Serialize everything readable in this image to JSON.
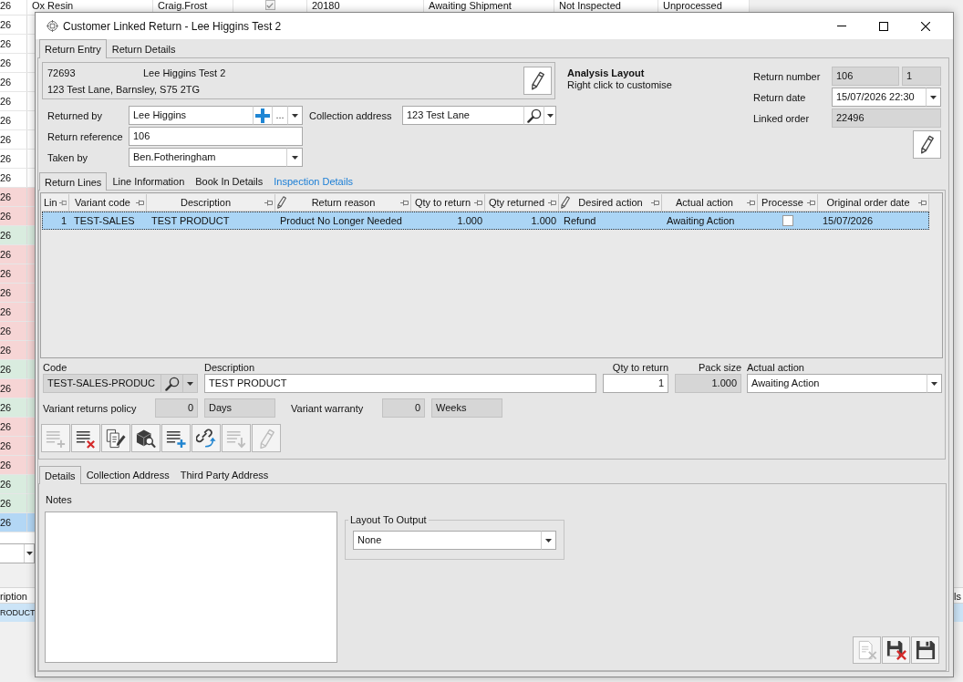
{
  "background_app": {
    "top_row": {
      "cells": [
        {
          "kind": "text",
          "text": "26"
        },
        {
          "kind": "text",
          "text": "Ox Resin"
        },
        {
          "kind": "text",
          "text": "Craig.Frost"
        },
        {
          "kind": "checkbox",
          "checked": true
        },
        {
          "kind": "text",
          "text": "20180"
        },
        {
          "kind": "text",
          "text": "Awaiting Shipment"
        },
        {
          "kind": "text",
          "text": "Not Inspected"
        },
        {
          "kind": "text",
          "text": "Unprocessed"
        }
      ]
    },
    "rows": [
      {
        "column_1": "26",
        "color": "#ffffff",
        "selected": false
      },
      {
        "column_1": "26",
        "color": "#ffffff",
        "selected": false
      },
      {
        "column_1": "26",
        "color": "#ffffff",
        "selected": false
      },
      {
        "column_1": "26",
        "color": "#ffffff",
        "selected": false
      },
      {
        "column_1": "26",
        "color": "#ffffff",
        "selected": false
      },
      {
        "column_1": "26",
        "color": "#ffffff",
        "selected": false
      },
      {
        "column_1": "26",
        "color": "#ffffff",
        "selected": false
      },
      {
        "column_1": "26",
        "color": "#ffffff",
        "selected": false
      },
      {
        "column_1": "26",
        "color": "#ffffff",
        "selected": false
      },
      {
        "column_1": "26",
        "color": "#f6d5d5",
        "selected": false
      },
      {
        "column_1": "26",
        "color": "#f6d5d5",
        "selected": false
      },
      {
        "column_1": "26",
        "color": "#d9ecdf",
        "selected": false
      },
      {
        "column_1": "26",
        "color": "#f6d5d5",
        "selected": false
      },
      {
        "column_1": "26",
        "color": "#f6d5d5",
        "selected": false
      },
      {
        "column_1": "26",
        "color": "#f6d5d5",
        "selected": false
      },
      {
        "column_1": "26",
        "color": "#f6d5d5",
        "selected": false
      },
      {
        "column_1": "26",
        "color": "#f6d5d5",
        "selected": false
      },
      {
        "column_1": "26",
        "color": "#f6d5d5",
        "selected": false
      },
      {
        "column_1": "26",
        "color": "#d9ecdf",
        "selected": false
      },
      {
        "column_1": "26",
        "color": "#f6d5d5",
        "selected": false
      },
      {
        "column_1": "26",
        "color": "#d9ecdf",
        "selected": false
      },
      {
        "column_1": "26",
        "color": "#f6d5d5",
        "selected": false
      },
      {
        "column_1": "26",
        "color": "#f6d5d5",
        "selected": false
      },
      {
        "column_1": "26",
        "color": "#f6d5d5",
        "selected": false
      },
      {
        "column_1": "26",
        "color": "#d9ecdf",
        "selected": false
      },
      {
        "column_1": "26",
        "color": "#d9ecdf",
        "selected": false
      },
      {
        "column_1": "26",
        "selected": true
      }
    ],
    "lower_grid": {
      "columns": [
        "ription",
        "ls"
      ],
      "rows": [
        {
          "column_1": "RODUCT",
          "selected": true
        }
      ]
    }
  },
  "dialog": {
    "title": "Customer Linked Return - Lee Higgins Test 2",
    "tabs": [
      {
        "label": "Return Entry",
        "selected": true
      },
      {
        "label": "Return Details",
        "selected": false
      }
    ],
    "customer": {
      "account": "72693",
      "name": "Lee Higgins Test 2",
      "address": "123 Test Lane, Barnsley, S75 2TG"
    },
    "returned_by": {
      "label": "Returned by",
      "value": "Lee Higgins",
      "more": "...",
      "readonly": false
    },
    "collection_address": {
      "label": "Collection address",
      "value": "123 Test Lane",
      "readonly": false
    },
    "return_reference": {
      "label": "Return reference",
      "value": "106",
      "readonly": false
    },
    "taken_by": {
      "label": "Taken by",
      "value": "Ben.Fotheringham",
      "readonly": false
    },
    "analysis_layout": {
      "title": "Analysis Layout",
      "hint": "Right click to customise"
    },
    "return_number": {
      "label": "Return number",
      "value": "106",
      "suffix": "1",
      "readonly": true
    },
    "return_date": {
      "label": "Return date",
      "value": "15/07/2026 22:30",
      "readonly": false
    },
    "linked_order": {
      "label": "Linked order",
      "value": "22496",
      "readonly": true
    },
    "line_tabs": [
      {
        "label": "Return Lines",
        "selected": true,
        "hovered": false
      },
      {
        "label": "Line Information",
        "selected": false,
        "hovered": false
      },
      {
        "label": "Book In Details",
        "selected": false,
        "hovered": false
      },
      {
        "label": "Inspection Details",
        "selected": false,
        "hovered": true
      }
    ],
    "lines_table": {
      "columns": [
        {
          "label": "Lin",
          "kind": "number",
          "editable": false
        },
        {
          "label": "Variant code",
          "kind": "text",
          "editable": false
        },
        {
          "label": "Description",
          "kind": "text",
          "editable": false
        },
        {
          "label": "Return reason",
          "kind": "text",
          "editable": true
        },
        {
          "label": "Qty to return",
          "kind": "number",
          "editable": false
        },
        {
          "label": "Qty returned",
          "kind": "number",
          "editable": false
        },
        {
          "label": "Desired action",
          "kind": "text",
          "editable": true
        },
        {
          "label": "Actual action",
          "kind": "text",
          "editable": false
        },
        {
          "label": "Processe",
          "kind": "checkbox",
          "editable": false
        },
        {
          "label": "Original order date",
          "kind": "text",
          "editable": false
        }
      ],
      "rows": [
        {
          "selected": true,
          "cells": [
            "1",
            "TEST-SALES",
            "TEST PRODUCT",
            "Product No Longer Needed",
            "1.000",
            "1.000",
            "Refund",
            "Awaiting Action",
            false,
            "15/07/2026"
          ]
        }
      ]
    },
    "line_detail": {
      "code": {
        "label": "Code",
        "value": "TEST-SALES-PRODUC",
        "readonly": true
      },
      "description": {
        "label": "Description",
        "value": "TEST PRODUCT",
        "readonly": false
      },
      "qty_to_return": {
        "label": "Qty to return",
        "value": "1",
        "readonly": false
      },
      "pack_size": {
        "label": "Pack size",
        "value": "1.000",
        "readonly": true
      },
      "actual_action": {
        "label": "Actual action",
        "value": "Awaiting Action",
        "readonly": false
      },
      "variant_returns_policy": {
        "label": "Variant returns policy",
        "value": "0",
        "unit": "Days",
        "readonly": true
      },
      "variant_warranty": {
        "label": "Variant warranty",
        "value": "0",
        "unit": "Weeks",
        "readonly": true
      }
    },
    "line_toolbar": [
      {
        "kind": "add",
        "disabled": true
      },
      {
        "kind": "delete",
        "disabled": false
      },
      {
        "kind": "amend",
        "disabled": false
      },
      {
        "kind": "lookup",
        "disabled": false
      },
      {
        "kind": "insert",
        "disabled": false
      },
      {
        "kind": "link",
        "disabled": false
      },
      {
        "kind": "import",
        "disabled": true
      },
      {
        "kind": "edit",
        "disabled": true
      }
    ],
    "detail_tabs": [
      {
        "label": "Details",
        "selected": true
      },
      {
        "label": "Collection Address",
        "selected": false
      },
      {
        "label": "Third Party Address",
        "selected": false
      }
    ],
    "notes": {
      "label": "Notes"
    },
    "layout_to_output": {
      "title": "Layout To Output",
      "value": "None"
    },
    "footer_buttons": [
      {
        "kind": "clear",
        "disabled": true
      },
      {
        "kind": "cancel",
        "disabled": false
      },
      {
        "kind": "save",
        "disabled": false
      }
    ]
  }
}
